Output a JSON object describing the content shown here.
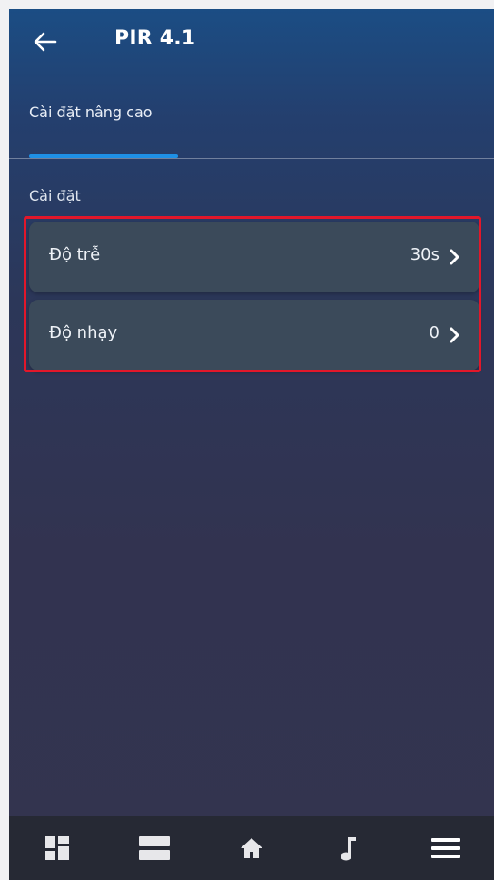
{
  "header": {
    "title": "PIR 4.1",
    "back_icon": "arrow-left-icon"
  },
  "tabs": [
    {
      "label": "Cài đặt nâng cao",
      "active": true
    }
  ],
  "section": {
    "label": "Cài đặt"
  },
  "settings": [
    {
      "label": "Độ trễ",
      "value": "30s",
      "icon": "chevron-right-icon"
    },
    {
      "label": "Độ nhạy",
      "value": "0",
      "icon": "chevron-right-icon"
    }
  ],
  "bottom_nav": [
    {
      "icon": "dashboard-icon"
    },
    {
      "icon": "list-icon"
    },
    {
      "icon": "home-icon"
    },
    {
      "icon": "music-note-icon"
    },
    {
      "icon": "menu-icon"
    }
  ],
  "colors": {
    "accent": "#1e90e6",
    "highlight": "#e2172a",
    "card": "#3b4a5a",
    "nav_bg": "#262934"
  }
}
